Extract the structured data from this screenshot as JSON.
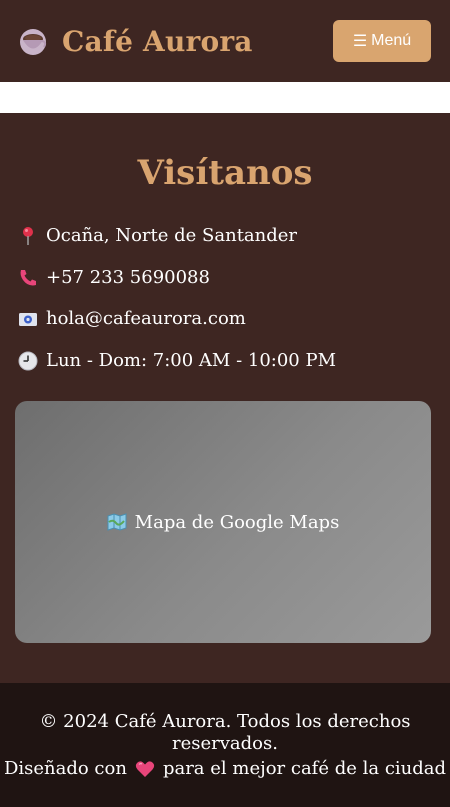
{
  "header": {
    "brand": "Café Aurora",
    "logo_icon": "coffee-cup-icon",
    "menu_icon": "hamburger-icon",
    "menu_bars": "☰",
    "menu_label": "Menú"
  },
  "visit": {
    "title": "Visítanos",
    "info": [
      {
        "icon": "pin-icon",
        "text": "Ocaña, Norte de Santander"
      },
      {
        "icon": "phone-icon",
        "text": "+57 233 5690088"
      },
      {
        "icon": "email-icon",
        "text": "hola@cafeaurora.com"
      },
      {
        "icon": "clock-icon",
        "text": "Lun - Dom: 7:00 AM - 10:00 PM"
      }
    ],
    "map": {
      "icon": "map-icon",
      "label": "Mapa de Google Maps"
    }
  },
  "footer": {
    "copyright": "© 2024 Café Aurora. Todos los derechos reservados.",
    "credit_before": "Diseñado con",
    "credit_icon": "heart-icon",
    "credit_after": "para el mejor café de la ciudad"
  },
  "colors": {
    "header_bg": "#3e2622",
    "accent": "#d9a46f",
    "footer_bg": "#1f1412"
  }
}
